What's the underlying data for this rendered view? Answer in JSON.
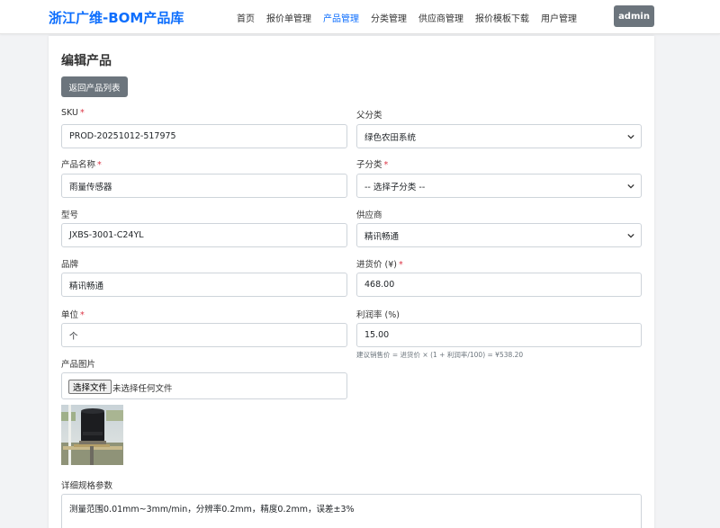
{
  "header": {
    "brand": "浙江广维-BOM产品库",
    "nav": [
      "首页",
      "报价单管理",
      "产品管理",
      "分类管理",
      "供应商管理",
      "报价模板下载",
      "用户管理"
    ],
    "active_nav": "产品管理",
    "user_label": "admin"
  },
  "page": {
    "title": "编辑产品",
    "back_label": "返回产品列表"
  },
  "form": {
    "sku": {
      "label": "SKU",
      "value": "PROD-20251012-517975"
    },
    "parent_category": {
      "label": "父分类",
      "value": "绿色农田系统"
    },
    "product_name": {
      "label": "产品名称",
      "value": "雨量传感器"
    },
    "sub_category": {
      "label": "子分类",
      "value": "-- 选择子分类 --"
    },
    "model": {
      "label": "型号",
      "value": "JXBS-3001-C24YL"
    },
    "supplier": {
      "label": "供应商",
      "value": "精讯畅通"
    },
    "brand": {
      "label": "品牌",
      "value": "精讯畅通"
    },
    "purchase_price": {
      "label": "进货价 (¥)",
      "value": "468.00"
    },
    "unit": {
      "label": "单位",
      "value": "个"
    },
    "profit_rate": {
      "label": "利润率 (%)",
      "value": "15.00"
    },
    "price_hint": "建议销售价 = 进货价 × (1 + 利润率/100) = ¥538.20",
    "image": {
      "label": "产品图片",
      "button_label": "选择文件",
      "status": "未选择任何文件"
    },
    "specs": {
      "label": "详细规格参数",
      "value": "测量范围0.01mm~3mm/min，分辨率0.2mm，精度0.2mm，误差±3%"
    },
    "required_mark": "*"
  },
  "colors": {
    "primary": "#0d6efd",
    "secondary": "#6c757d",
    "danger": "#dc3545"
  }
}
